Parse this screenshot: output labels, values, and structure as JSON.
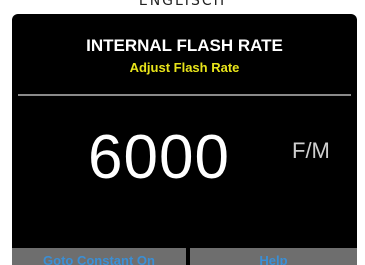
{
  "caption": "ENGLISCH",
  "screen": {
    "title": "INTERNAL FLASH RATE",
    "subtitle": "Adjust Flash Rate",
    "rate_value": "6000",
    "rate_unit": "F/M"
  },
  "buttons": {
    "goto_constant_on": "Goto Constant On",
    "help": "Help"
  },
  "colors": {
    "screen_background": "#000000",
    "subtitle_yellow": "#e8e41a",
    "button_gray": "#6e6e6e",
    "button_text_blue": "#3a8fd6"
  }
}
